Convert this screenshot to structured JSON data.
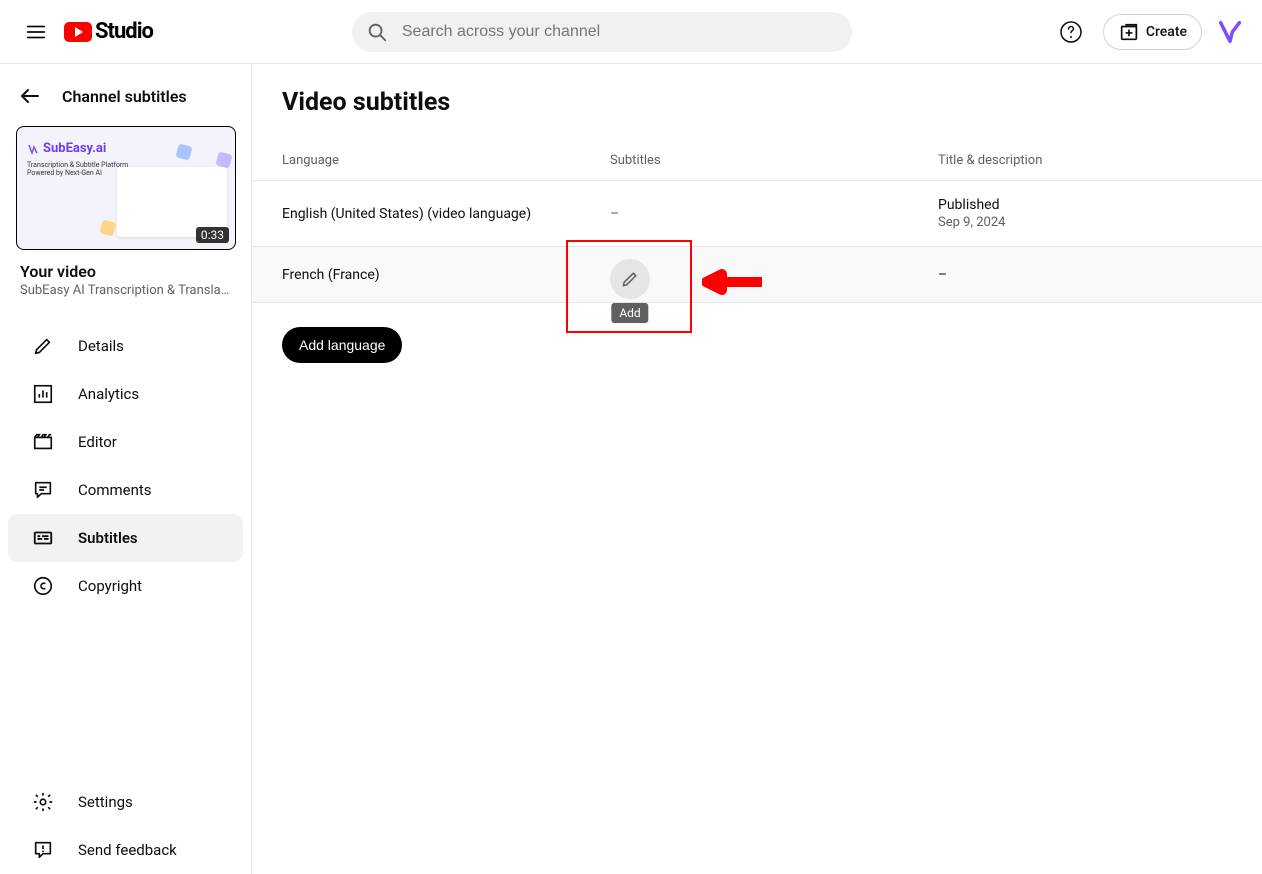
{
  "header": {
    "logo_text": "Studio",
    "search_placeholder": "Search across your channel",
    "create_label": "Create"
  },
  "sidebar": {
    "back_label": "Channel subtitles",
    "video_heading": "Your video",
    "video_title": "SubEasy AI Transcription & Translati...",
    "thumb_brand": "SubEasy.ai",
    "thumb_sub1": "Transcription & Subtitle Platform",
    "thumb_sub2": "Powered by Next-Gen AI",
    "thumb_duration": "0:33",
    "nav": [
      {
        "label": "Details"
      },
      {
        "label": "Analytics"
      },
      {
        "label": "Editor"
      },
      {
        "label": "Comments"
      },
      {
        "label": "Subtitles"
      },
      {
        "label": "Copyright"
      }
    ],
    "nav_bottom": [
      {
        "label": "Settings"
      },
      {
        "label": "Send feedback"
      }
    ]
  },
  "content": {
    "page_title": "Video subtitles",
    "columns": {
      "lang": "Language",
      "subs": "Subtitles",
      "title": "Title & description"
    },
    "rows": [
      {
        "lang": "English (United States) (video language)",
        "subs": "–",
        "status": "Published",
        "date": "Sep 9, 2024"
      },
      {
        "lang": "French (France)",
        "subs_tooltip": "Add",
        "title_dash": "–"
      }
    ],
    "add_language": "Add language"
  }
}
